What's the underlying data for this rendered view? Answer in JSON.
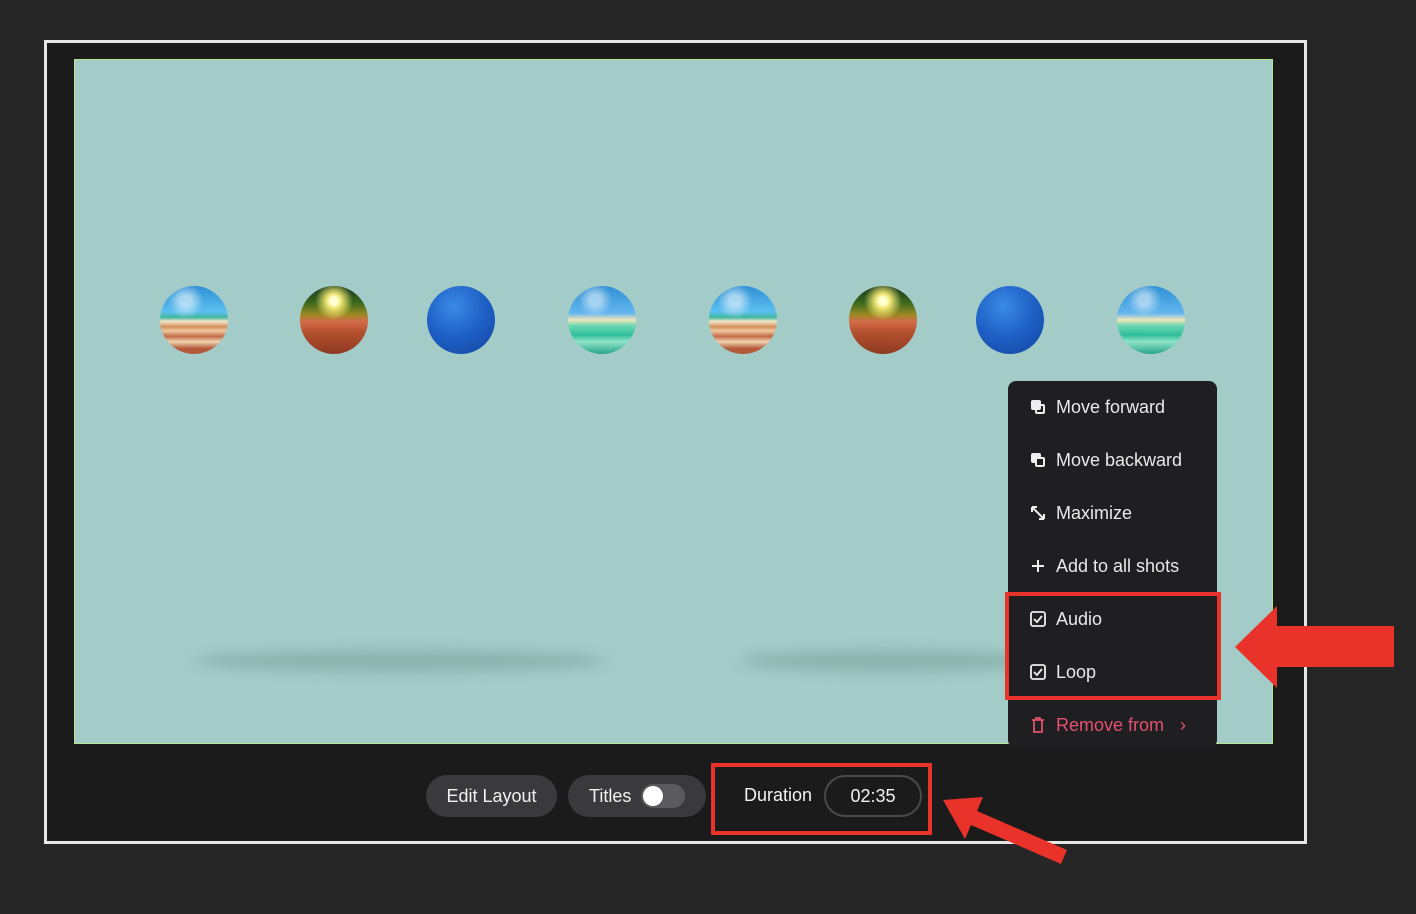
{
  "canvas": {
    "balls": [
      {
        "style": "striped"
      },
      {
        "style": "gold"
      },
      {
        "style": "blue"
      },
      {
        "style": "mint"
      },
      {
        "style": "striped"
      },
      {
        "style": "gold"
      },
      {
        "style": "blue"
      },
      {
        "style": "mint"
      }
    ]
  },
  "context_menu": {
    "items": [
      {
        "label": "Move forward",
        "icon": "move-forward-icon"
      },
      {
        "label": "Move backward",
        "icon": "move-backward-icon"
      },
      {
        "label": "Maximize",
        "icon": "maximize-icon"
      },
      {
        "label": "Add to all shots",
        "icon": "plus-icon"
      },
      {
        "label": "Audio",
        "icon": "checkbox-checked-icon",
        "checked": true
      },
      {
        "label": "Loop",
        "icon": "checkbox-checked-icon",
        "checked": true
      },
      {
        "label": "Remove from",
        "icon": "trash-icon",
        "danger": true
      }
    ]
  },
  "toolbar": {
    "edit_layout_label": "Edit Layout",
    "titles_label": "Titles",
    "titles_enabled": false,
    "duration_label": "Duration",
    "duration_value": "02:35"
  },
  "colors": {
    "highlight": "#e8322a",
    "danger": "#e2526e",
    "canvas_bg": "#a3ccc9"
  }
}
